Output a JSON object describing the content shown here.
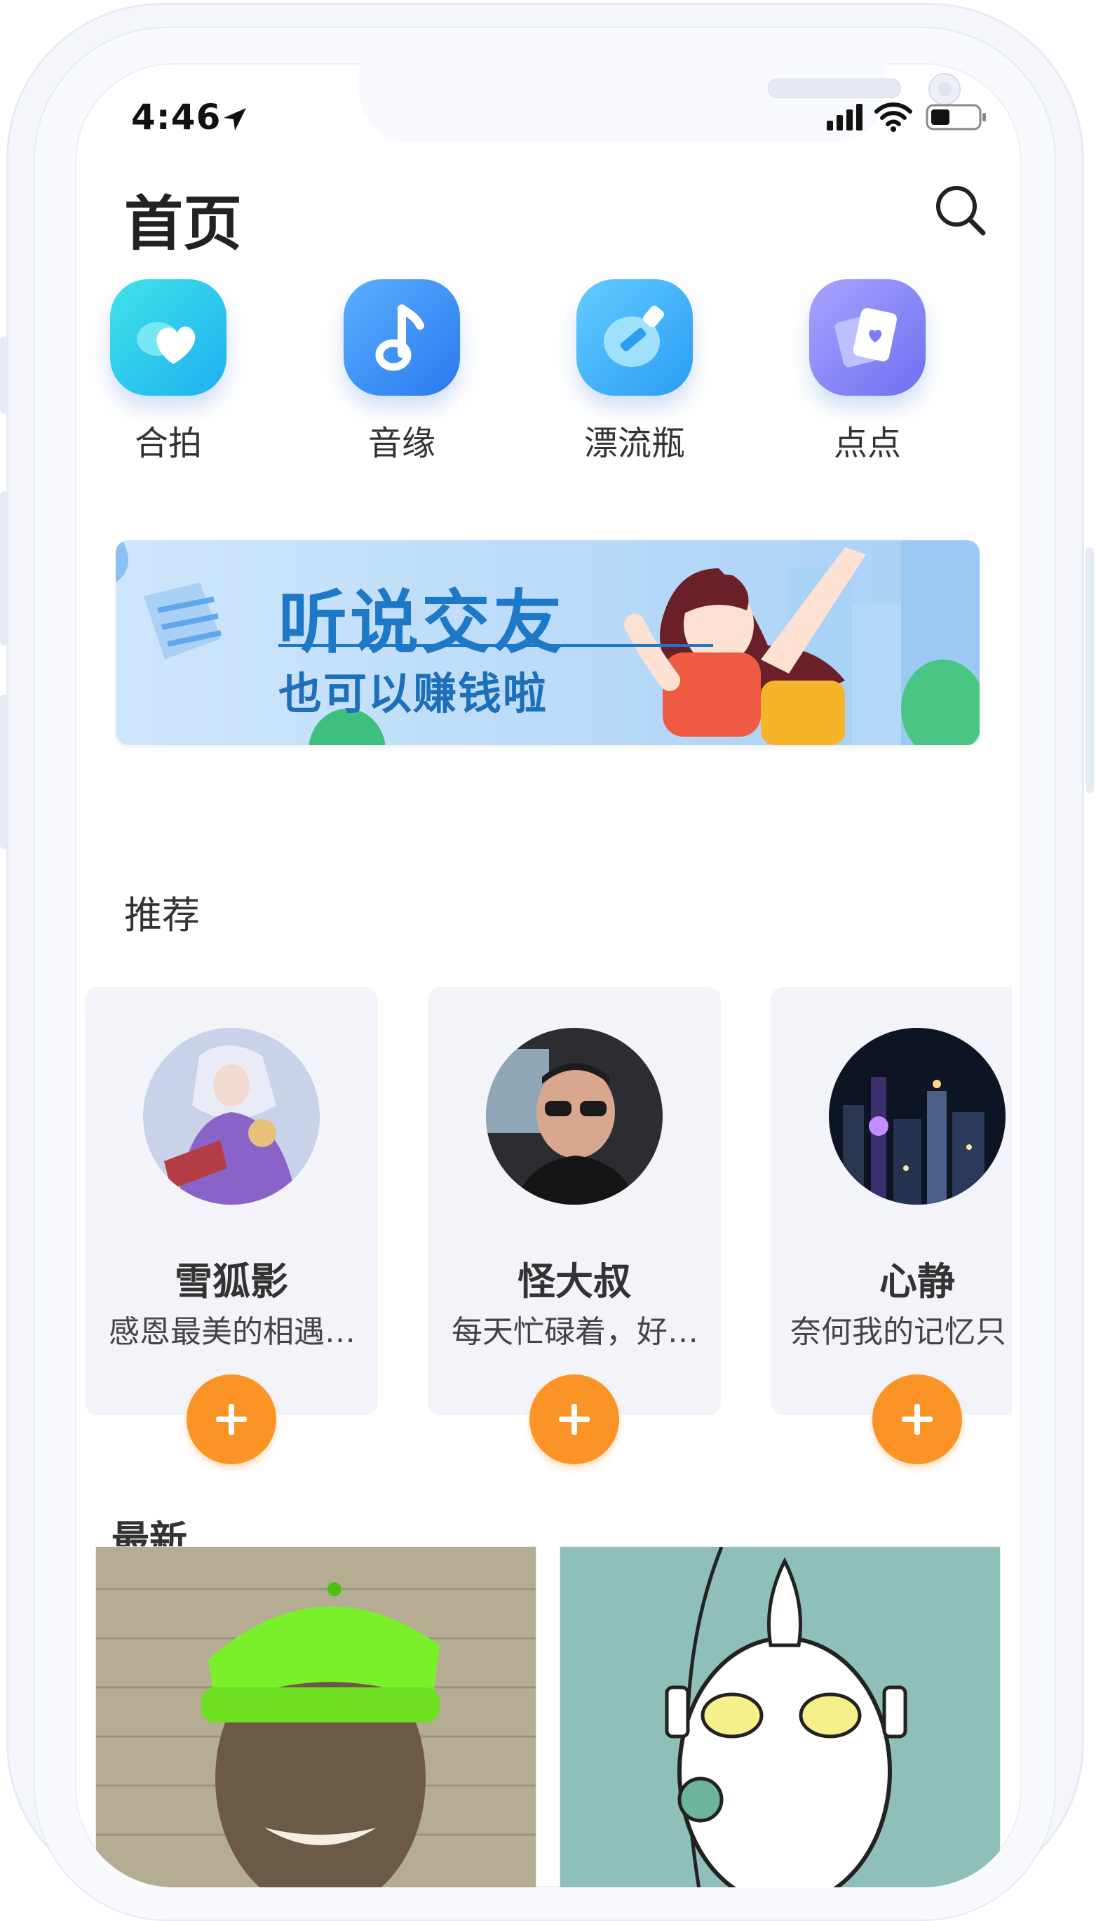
{
  "status_bar": {
    "time": "4:46"
  },
  "header": {
    "title": "首页"
  },
  "quick_actions": [
    {
      "label": "合拍",
      "icon": "heart-cloud-icon"
    },
    {
      "label": "音缘",
      "icon": "music-note-icon"
    },
    {
      "label": "漂流瓶",
      "icon": "drift-bottle-icon"
    },
    {
      "label": "点点",
      "icon": "heart-card-icon"
    }
  ],
  "banner": {
    "title": "听说交友",
    "subtitle": "也可以赚钱啦"
  },
  "recommend": {
    "title": "推荐",
    "users": [
      {
        "name": "雪狐影",
        "bio": "感恩最美的相遇…"
      },
      {
        "name": "怪大叔",
        "bio": "每天忙碌着，好…"
      },
      {
        "name": "心静",
        "bio": "奈何我的记忆只"
      }
    ]
  },
  "latest": {
    "title": "最新"
  },
  "colors": {
    "accent_orange": "#fb9427",
    "banner_blue": "#1e78c8",
    "text_dark": "#222222"
  }
}
